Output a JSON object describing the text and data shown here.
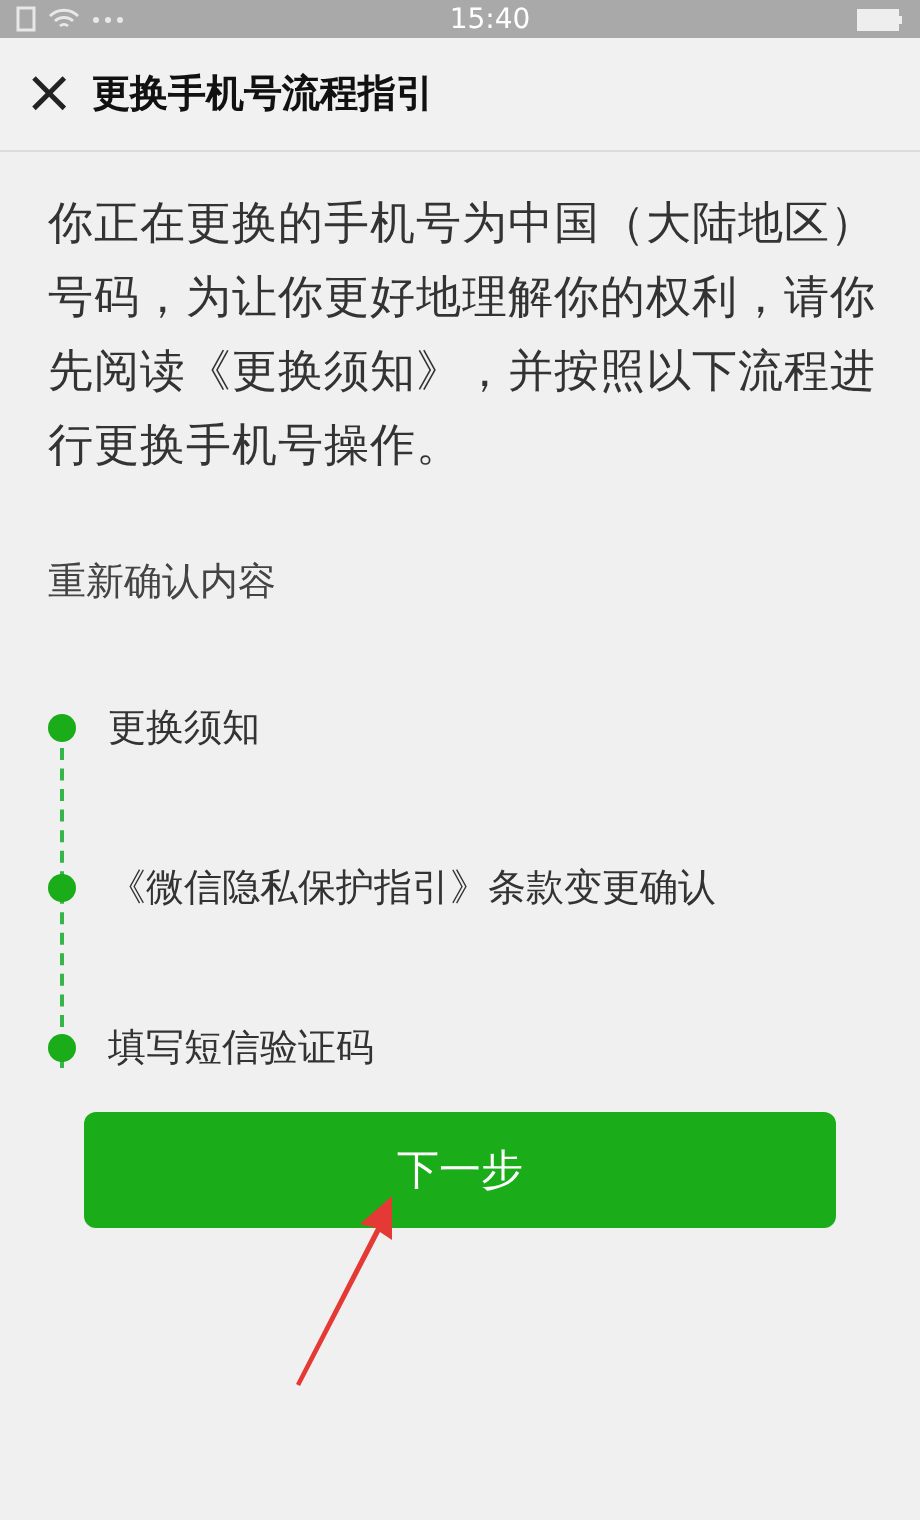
{
  "status_bar": {
    "time": "15:40"
  },
  "header": {
    "close": "×",
    "title": "更换手机号流程指引"
  },
  "intro": "你正在更换的手机号为中国（大陆地区）号码，为让你更好地理解你的权利，请你先阅读《更换须知》，并按照以下流程进行更换手机号操作。",
  "section_title": "重新确认内容",
  "steps": [
    {
      "label": "更换须知"
    },
    {
      "label": "《微信隐私保护指引》条款变更确认"
    },
    {
      "label": "填写短信验证码"
    }
  ],
  "next_button": "下一步"
}
